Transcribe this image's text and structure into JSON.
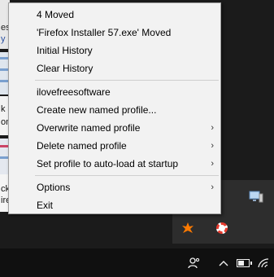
{
  "menu": {
    "history_items": [
      {
        "label": "4 Moved"
      },
      {
        "label": "'Firefox Installer 57.exe' Moved"
      },
      {
        "label": "Initial History"
      },
      {
        "label": "Clear History"
      }
    ],
    "profile_items": [
      {
        "label": "ilovefreesoftware"
      },
      {
        "label": "Create new named profile..."
      },
      {
        "label": "Overwrite named profile",
        "submenu": true
      },
      {
        "label": "Delete named profile",
        "submenu": true
      },
      {
        "label": "Set profile to auto-load at startup",
        "submenu": true
      }
    ],
    "footer_items": [
      {
        "label": "Options",
        "submenu": true
      },
      {
        "label": "Exit"
      }
    ],
    "submenu_arrow": "›"
  },
  "background": {
    "strip1": [
      "est",
      "y lo"
    ],
    "strip3": [
      "k s",
      "on"
    ],
    "strip5": [
      "ck",
      "ire"
    ]
  },
  "tray": {
    "icons": [
      "pc-icon",
      "avast-icon",
      "lifebuoy-icon"
    ]
  },
  "taskbar": {
    "icons": [
      "people-icon",
      "chevron-up-icon",
      "battery-icon",
      "wifi-icon"
    ]
  }
}
